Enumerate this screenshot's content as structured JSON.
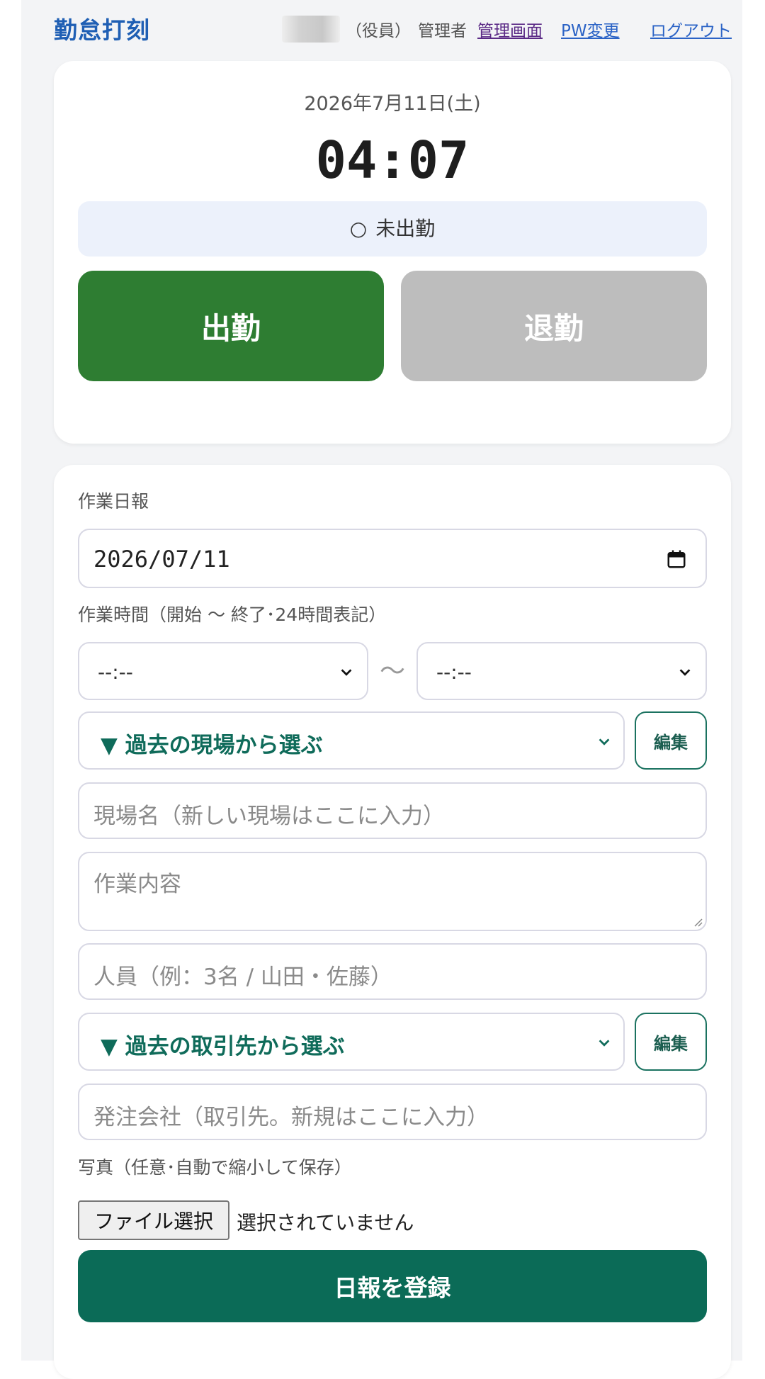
{
  "header": {
    "app_title": "勤怠打刻",
    "user_role": "（役員）",
    "admin_label": "管理者",
    "links": {
      "admin": "管理画面",
      "password": "PW変更",
      "logout": "ログアウト"
    }
  },
  "clock": {
    "date": "2026年7月11日(土)",
    "time": "04:07",
    "status_icon": "○",
    "status": "未出勤",
    "clock_in_label": "出勤",
    "clock_out_label": "退勤"
  },
  "report": {
    "section_label": "作業日報",
    "date_value": "2026/07/11",
    "time_label": "作業時間（開始 〜 終了･24時間表記）",
    "start_time_value": "--:--",
    "end_time_value": "--:--",
    "time_separator": "〜",
    "site_select": "▼ 過去の現場から選ぶ",
    "edit_label": "編集",
    "site_name_placeholder": "現場名（新しい現場はここに入力）",
    "work_content_placeholder": "作業内容",
    "people_placeholder": "人員（例：3名 / 山田・佐藤）",
    "client_select": "▼ 過去の取引先から選ぶ",
    "company_placeholder": "発注会社（取引先。新規はここに入力）",
    "photo_label": "写真（任意･自動で縮小して保存）",
    "file_button": "ファイル選択",
    "file_status": "選択されていません",
    "submit_label": "日報を登録"
  },
  "colors": {
    "brand": "#1f5fb4",
    "clock_in": "#2e7d32",
    "clock_out_disabled": "#bdbdbd",
    "accent_green": "#0b6b57",
    "status_bg": "#ecf1fb"
  }
}
